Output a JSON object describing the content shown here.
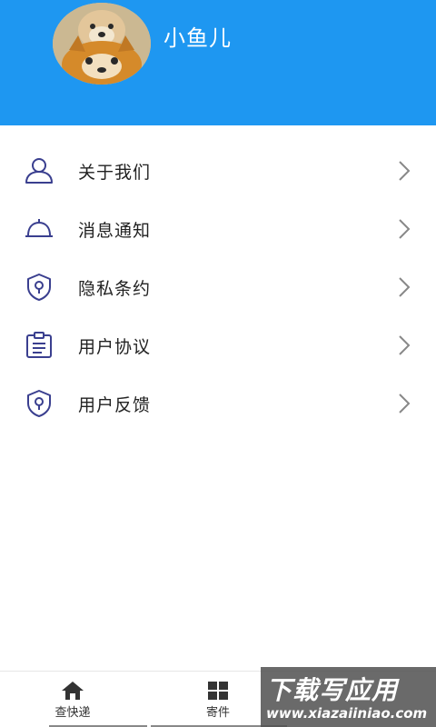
{
  "profile": {
    "username": "小鱼儿",
    "avatar_icon": "shiba-dog-avatar"
  },
  "menu": {
    "items": [
      {
        "label": "关于我们",
        "icon": "user-icon"
      },
      {
        "label": "消息通知",
        "icon": "bell-icon"
      },
      {
        "label": "隐私条约",
        "icon": "shield-icon"
      },
      {
        "label": "用户协议",
        "icon": "clipboard-icon"
      },
      {
        "label": "用户反馈",
        "icon": "shield-icon"
      }
    ]
  },
  "bottom_nav": {
    "items": [
      {
        "label": "查快递",
        "icon": "home-icon"
      },
      {
        "label": "寄件",
        "icon": "grid-icon"
      }
    ]
  },
  "watermark": {
    "title": "下载写应用",
    "url": "www.xiazaiiniao.com"
  },
  "colors": {
    "header": "#1E97F1",
    "icon": "#3A3F8F",
    "chevron": "#888888"
  }
}
